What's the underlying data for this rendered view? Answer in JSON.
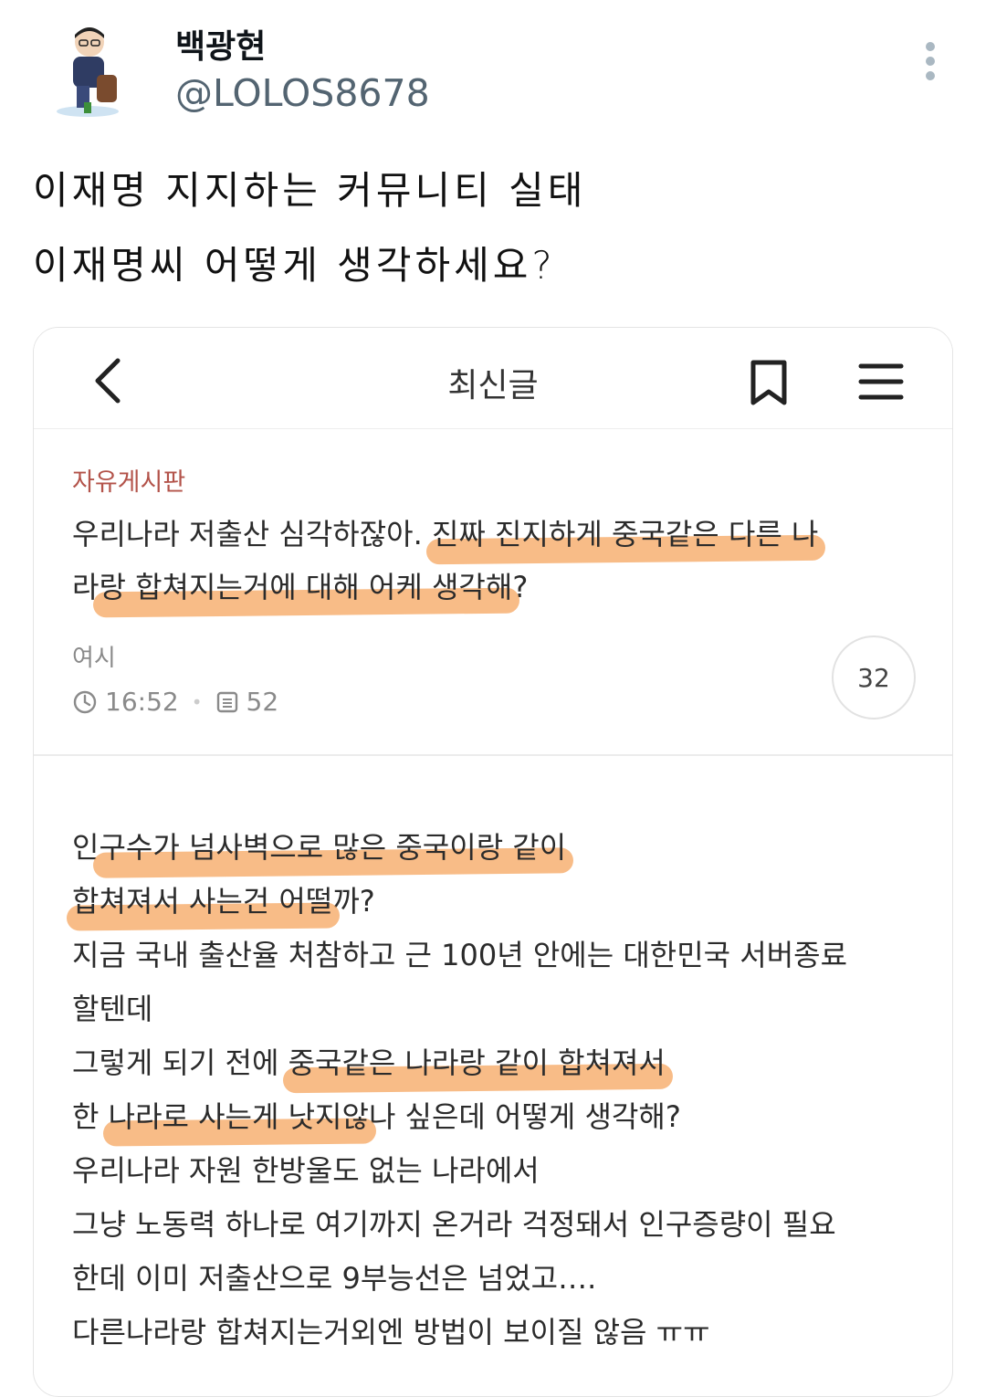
{
  "tweet": {
    "display_name": "백광현",
    "handle": "@LOLOS8678",
    "text_lines": [
      "이재명 지지하는 커뮤니티 실태",
      "이재명씨 어떻게 생각하세요?"
    ]
  },
  "screenshot": {
    "appbar": {
      "title": "최신글"
    },
    "post": {
      "board": "자유게시판",
      "title_plain_1": "우리나라 저출산 심각하잖아. ",
      "title_hl_1": "진짜 진지하게 중국같은 다른 나",
      "title_plain_2": "라",
      "title_hl_2": "랑 합쳐지는거에 대해 어케 생각해",
      "title_plain_3": "?",
      "author": "여시",
      "time": "16:52",
      "views": "52",
      "comment_count": "32"
    },
    "body": {
      "line1_a": "인",
      "line1_hl": "구수가 넘사벽으로 많은 중국이랑 같이",
      "line2_hl": "합쳐져서 사는건 어떨",
      "line2_b": "까?",
      "line3": "지금 국내 출산율 처참하고 근 100년 안에는 대한민국 서버종료",
      "line4": "할텐데",
      "line5_a": "그렇게 되기 전에 ",
      "line5_hl": "중국같은 나라랑 같이 합쳐져서",
      "line6_a": "한 ",
      "line6_hl": "나라로 사는게 낫지않",
      "line6_b": "나 싶은데 어떻게 생각해?",
      "line7": "우리나라 자원 한방울도 없는 나라에서",
      "line8": "그냥 노동력 하나로 여기까지 온거라 걱정돼서 인구증량이 필요",
      "line9": "한데 이미 저출산으로 9부능선은 넘었고….",
      "line10": "다른나라랑 합쳐지는거외엔 방법이 보이질 않음 ㅠㅠ"
    }
  },
  "colors": {
    "highlight": "#f6a65f",
    "board_label": "#b3534a",
    "handle": "#536471"
  }
}
